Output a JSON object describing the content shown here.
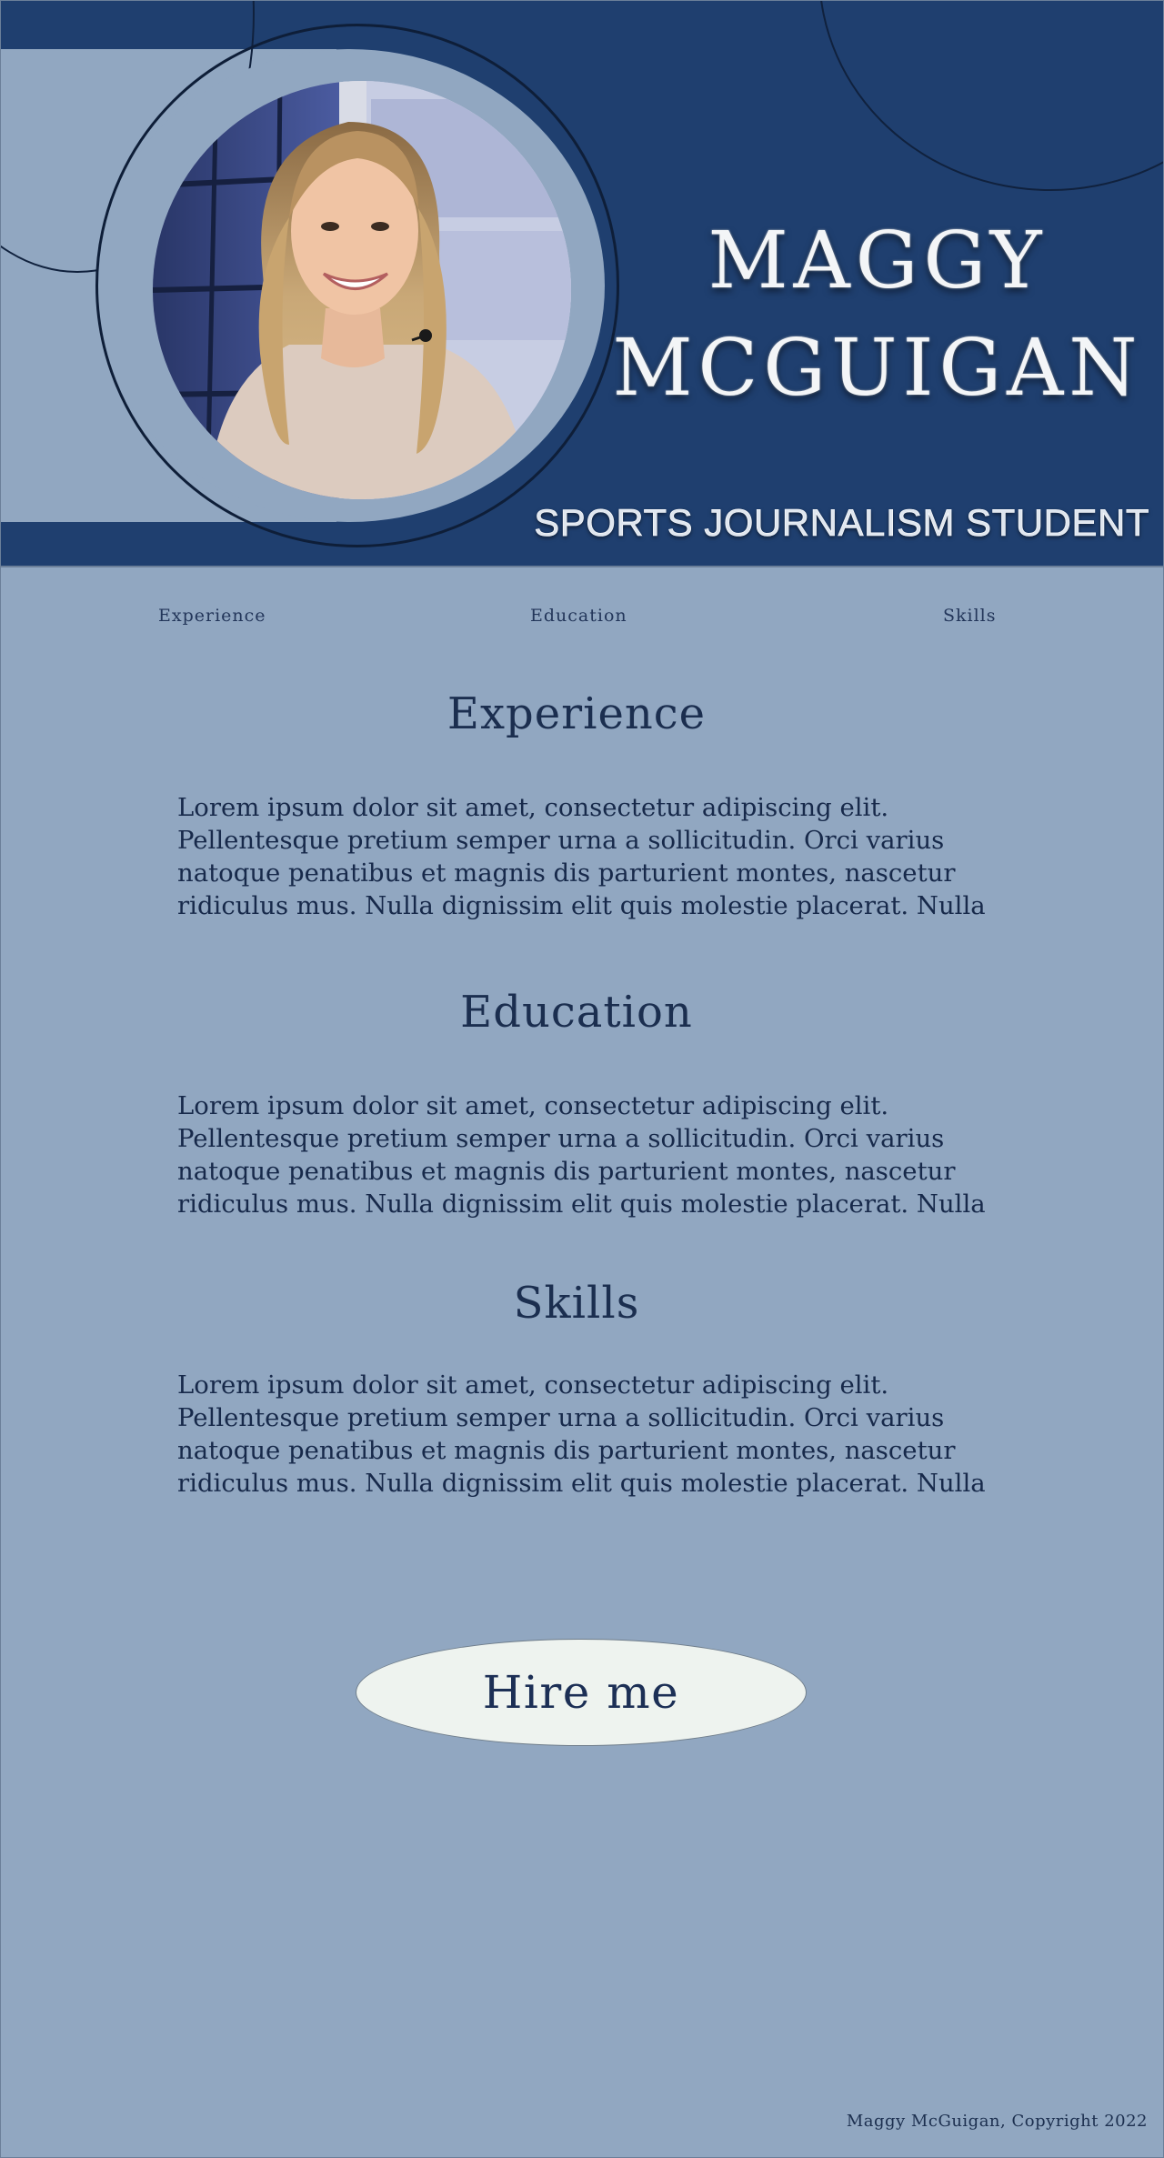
{
  "header": {
    "name_line1": "MAGGY",
    "name_line2": "MCGUIGAN",
    "subtitle": "SPORTS JOURNALISM STUDENT",
    "portrait_icon": "profile-photo"
  },
  "nav": {
    "items": [
      {
        "label": "Experience"
      },
      {
        "label": "Education"
      },
      {
        "label": "Skills"
      }
    ]
  },
  "sections": {
    "experience": {
      "heading": "Experience",
      "body": "Lorem ipsum dolor sit amet, consectetur adipiscing elit. Pellentesque pretium semper urna a sollicitudin. Orci varius natoque penatibus et magnis dis parturient montes, nascetur ridiculus mus. Nulla dignissim elit quis molestie placerat. Nulla"
    },
    "education": {
      "heading": "Education",
      "body": "Lorem ipsum dolor sit amet, consectetur adipiscing elit. Pellentesque pretium semper urna a sollicitudin. Orci varius natoque penatibus et magnis dis parturient montes, nascetur ridiculus mus. Nulla dignissim elit quis molestie placerat. Nulla"
    },
    "skills": {
      "heading": "Skills",
      "body": "Lorem ipsum dolor sit amet, consectetur adipiscing elit. Pellentesque pretium semper urna a sollicitudin. Orci varius natoque penatibus et magnis dis parturient montes, nascetur ridiculus mus. Nulla dignissim elit quis molestie placerat. Nulla"
    }
  },
  "cta": {
    "hire_label": "Hire me"
  },
  "footer": {
    "copyright": "Maggy McGuigan, Copyright 2022"
  },
  "colors": {
    "header_bg": "#1f3f6f",
    "page_bg": "#91a7c1",
    "text_dark": "#1b2e4f",
    "button_bg": "#eef3ef"
  }
}
